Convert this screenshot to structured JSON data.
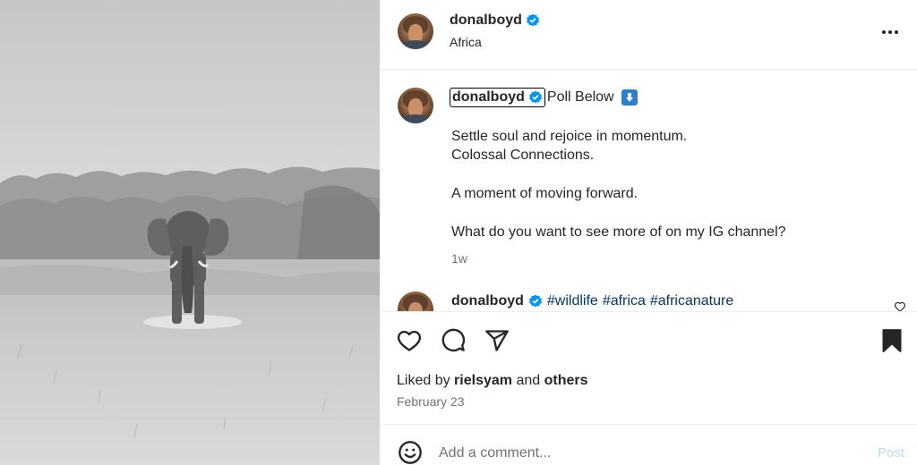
{
  "photo": {
    "icon": "elephant-photo"
  },
  "header": {
    "username": "donalboyd",
    "location": "Africa",
    "verified_icon": "verified-badge-icon",
    "more_icon": "more-options-icon"
  },
  "caption": {
    "username": "donalboyd",
    "title": "Poll Below",
    "lines": [
      "Settle soul and rejoice in momentum.",
      "Colossal Connections.",
      "A moment of moving forward.",
      "What do you want to see more of on my IG channel?"
    ],
    "time": "1w"
  },
  "second_comment": {
    "username": "donalboyd",
    "hashtags": [
      "#wildlife",
      "#africa",
      "#africanature"
    ]
  },
  "actions": {
    "like_icon": "heart-icon",
    "comment_icon": "comment-icon",
    "share_icon": "share-icon",
    "save_icon": "bookmark-icon"
  },
  "likes": {
    "prefix": "Liked by",
    "user": "rielsyam",
    "connector": "and",
    "others": "others"
  },
  "date": "February 23",
  "comment_bar": {
    "placeholder": "Add a comment...",
    "post_label": "Post",
    "emoji_icon": "emoji-icon"
  },
  "colors": {
    "verified": "#0095f6",
    "hashtag": "#00376b",
    "secondary_text": "#737373",
    "post_disabled": "#b2dffc"
  }
}
